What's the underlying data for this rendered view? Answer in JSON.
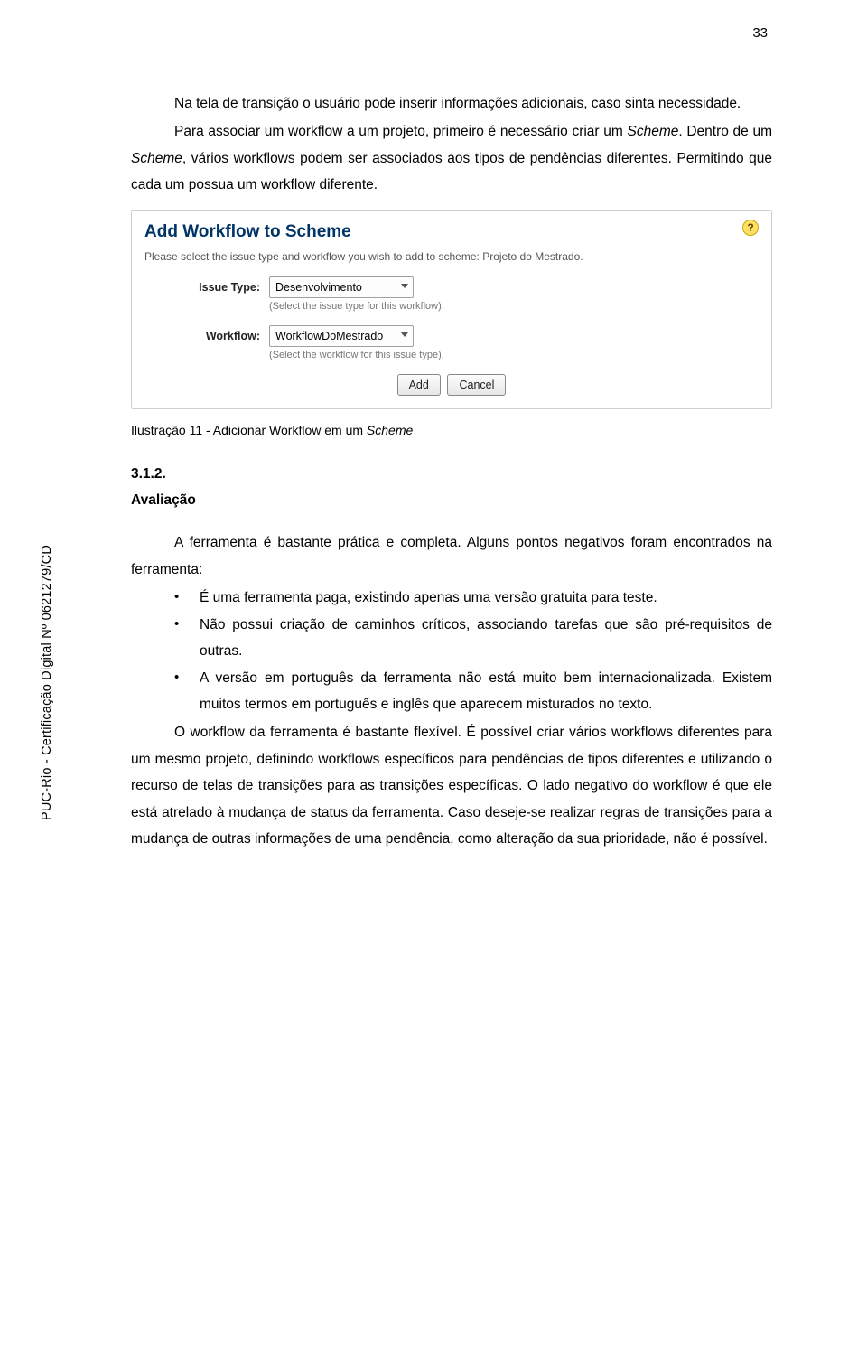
{
  "page_number": "33",
  "para1_a": "Na tela de transição o usuário pode inserir informações adicionais, caso sinta necessidade.",
  "para2_a": "Para associar um workflow a um projeto, primeiro é necessário criar um ",
  "para2_b": "Scheme",
  "para2_c": ". Dentro de um ",
  "para2_d": "Scheme",
  "para2_e": ", vários workflows podem ser associados aos tipos de pendências diferentes. Permitindo que cada um possua um workflow diferente.",
  "shot": {
    "title": "Add Workflow to Scheme",
    "desc": "Please select the issue type and workflow you wish to add to scheme: Projeto do Mestrado.",
    "label_issue": "Issue Type:",
    "issue_value": "Desenvolvimento",
    "issue_hint": "(Select the issue type for this workflow).",
    "label_workflow": "Workflow:",
    "workflow_value": "WorkflowDoMestrado",
    "workflow_hint": "(Select the workflow for this issue type).",
    "btn_add": "Add",
    "btn_cancel": "Cancel"
  },
  "caption_a": "Ilustração 11 - Adicionar Workflow em um ",
  "caption_b": "Scheme",
  "section_num": "3.1.2.",
  "section_title": "Avaliação",
  "para3": "A ferramenta é bastante prática e completa. Alguns pontos negativos foram encontrados na ferramenta:",
  "bullets": [
    "É uma ferramenta paga, existindo apenas uma versão gratuita para teste.",
    "Não possui criação de caminhos críticos, associando tarefas que são pré-requisitos de outras.",
    "A versão em português da ferramenta não está muito bem internacionalizada. Existem muitos termos em português e inglês que aparecem misturados no texto."
  ],
  "para4": "O workflow da ferramenta é bastante flexível. É possível criar vários workflows diferentes para um mesmo projeto, definindo workflows específicos para pendências de tipos diferentes e utilizando o recurso de telas de transições para as transições específicas. O lado negativo do workflow é que ele está atrelado à mudança de status da ferramenta. Caso deseje-se realizar regras de transições para a mudança de outras informações de uma pendência, como alteração da sua prioridade, não é possível.",
  "side_text": "PUC-Rio - Certificação Digital Nº 0621279/CD"
}
